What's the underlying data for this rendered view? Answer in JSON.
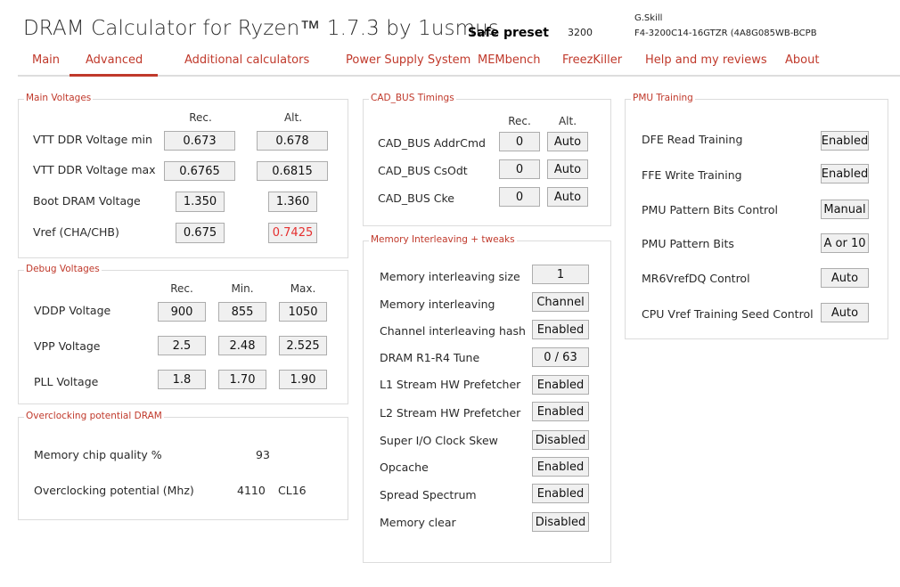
{
  "header": {
    "title": "DRAM Calculator for Ryzen™ 1.7.3 by 1usmus",
    "preset_label": "Safe preset",
    "preset_value": "3200",
    "memory_brand": "G.Skill",
    "memory_part": "F4-3200C14-16GTZR (4A8G085WB-BCPB"
  },
  "nav": [
    "Main",
    "Advanced",
    "Additional calculators",
    "Power Supply System",
    "MEMbench",
    "FreezKiller",
    "Help and my reviews",
    "About"
  ],
  "nav_active": "Advanced",
  "colors": {
    "accent": "#c0392b",
    "warning_value": "#e53030"
  },
  "main_voltages": {
    "legend": "Main Voltages",
    "col_rec": "Rec.",
    "col_alt": "Alt.",
    "rows": [
      {
        "label": "VTT DDR Voltage min",
        "rec": "0.673",
        "alt": "0.678"
      },
      {
        "label": "VTT DDR Voltage max",
        "rec": "0.6765",
        "alt": "0.6815"
      },
      {
        "label": "Boot DRAM Voltage",
        "rec": "1.350",
        "alt": "1.360"
      },
      {
        "label": "Vref (CHA/CHB)",
        "rec": "0.675",
        "alt": "0.7425"
      }
    ]
  },
  "debug_voltages": {
    "legend": "Debug Voltages",
    "col_rec": "Rec.",
    "col_min": "Min.",
    "col_max": "Max.",
    "rows": [
      {
        "label": "VDDP Voltage",
        "rec": "900",
        "min": "855",
        "max": "1050"
      },
      {
        "label": "VPP Voltage",
        "rec": "2.5",
        "min": "2.48",
        "max": "2.525"
      },
      {
        "label": "PLL Voltage",
        "rec": "1.8",
        "min": "1.70",
        "max": "1.90"
      }
    ]
  },
  "oc_potential": {
    "legend": "Overclocking potential DRAM",
    "chip_quality_label": "Memory chip quality %",
    "chip_quality_value": "93",
    "oc_label": "Overclocking potential (Mhz)",
    "oc_value": "4110",
    "oc_cl": "CL16"
  },
  "cad_bus": {
    "legend": "CAD_BUS Timings",
    "col_rec": "Rec.",
    "col_alt": "Alt.",
    "rows": [
      {
        "label": "CAD_BUS AddrCmd",
        "rec": "0",
        "alt": "Auto"
      },
      {
        "label": "CAD_BUS CsOdt",
        "rec": "0",
        "alt": "Auto"
      },
      {
        "label": "CAD_BUS Cke",
        "rec": "0",
        "alt": "Auto"
      }
    ]
  },
  "mem_interleaving": {
    "legend": "Memory Interleaving + tweaks",
    "rows": [
      {
        "label": "Memory interleaving size",
        "value": "1"
      },
      {
        "label": "Memory interleaving",
        "value": "Channel"
      },
      {
        "label": "Channel interleaving hash",
        "value": "Enabled"
      },
      {
        "label": "DRAM R1-R4 Tune",
        "value": "0 / 63"
      },
      {
        "label": "L1 Stream HW Prefetcher",
        "value": "Enabled"
      },
      {
        "label": "L2 Stream HW Prefetcher",
        "value": "Enabled"
      },
      {
        "label": "Super I/O Clock Skew",
        "value": "Disabled"
      },
      {
        "label": "Opcache",
        "value": "Enabled"
      },
      {
        "label": "Spread Spectrum",
        "value": "Enabled"
      },
      {
        "label": "Memory clear",
        "value": "Disabled"
      }
    ]
  },
  "pmu_training": {
    "legend": "PMU Training",
    "rows": [
      {
        "label": "DFE Read Training",
        "value": "Enabled"
      },
      {
        "label": "FFE Write Training",
        "value": "Enabled"
      },
      {
        "label": "PMU Pattern Bits Control",
        "value": "Manual"
      },
      {
        "label": "PMU Pattern Bits",
        "value": "A or 10"
      },
      {
        "label": "MR6VrefDQ Control",
        "value": "Auto"
      },
      {
        "label": "CPU Vref Training Seed Control",
        "value": "Auto"
      }
    ]
  }
}
